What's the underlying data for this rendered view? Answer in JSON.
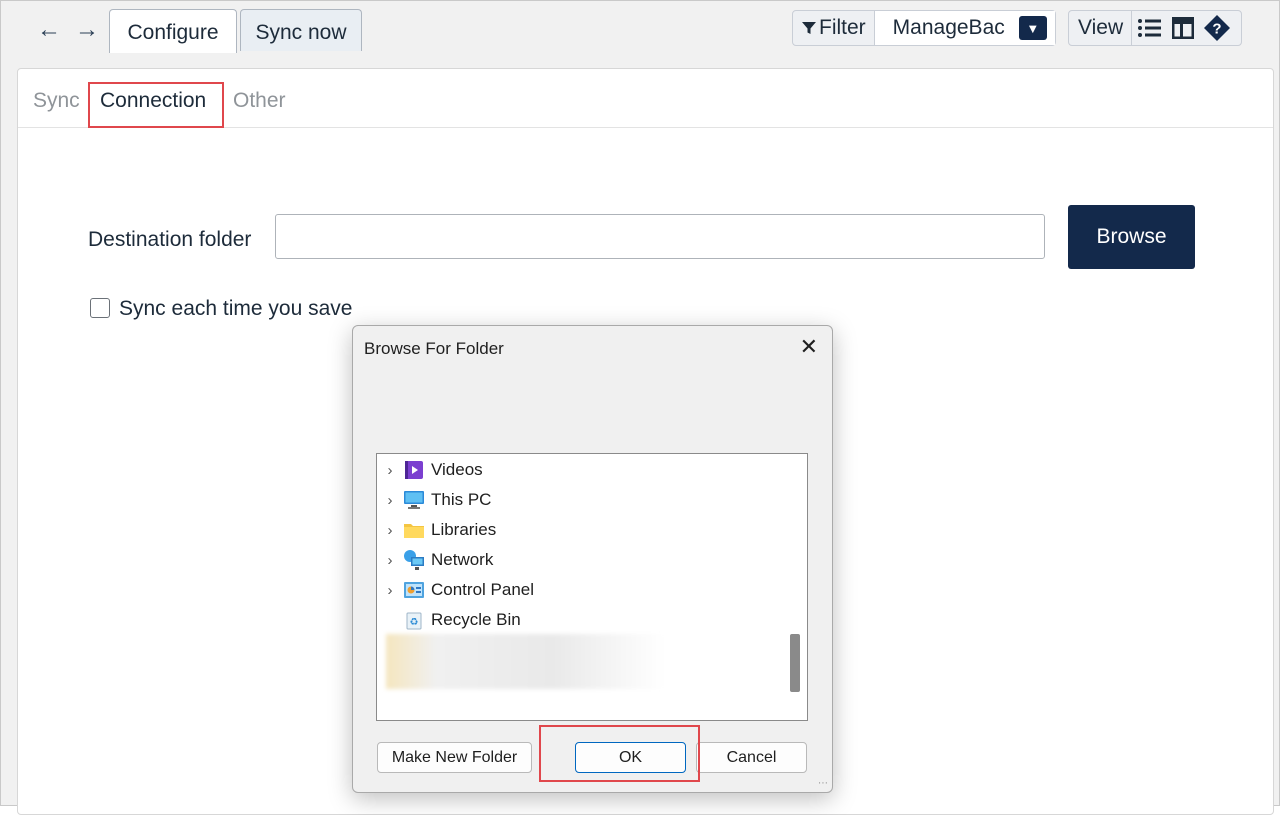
{
  "topbar": {
    "back_icon": "arrow-left-icon",
    "forward_icon": "arrow-right-icon",
    "tabs": [
      {
        "label": "Configure"
      },
      {
        "label": "Sync now"
      }
    ],
    "filter_label": "Filter",
    "source_label": "ManageBac",
    "view_label": "View"
  },
  "subtabs": [
    {
      "label": "Sync"
    },
    {
      "label": "Connection"
    },
    {
      "label": "Other"
    }
  ],
  "form": {
    "destination_label": "Destination folder",
    "destination_value": "",
    "browse_label": "Browse",
    "sync_each_save_label": "Sync each time you save"
  },
  "dialog": {
    "title": "Browse For Folder",
    "close_glyph": "✕",
    "items": [
      {
        "label": "Videos",
        "icon": "videos-folder-icon"
      },
      {
        "label": "This PC",
        "icon": "computer-icon"
      },
      {
        "label": "Libraries",
        "icon": "libraries-folder-icon"
      },
      {
        "label": "Network",
        "icon": "network-icon"
      },
      {
        "label": "Control Panel",
        "icon": "control-panel-icon"
      },
      {
        "label": "Recycle Bin",
        "icon": "recycle-bin-icon"
      }
    ],
    "make_new_folder_label": "Make New Folder",
    "ok_label": "OK",
    "cancel_label": "Cancel"
  },
  "colors": {
    "accent_dark": "#13294b",
    "highlight": "#e0474c",
    "default_button_border": "#0067c0"
  }
}
